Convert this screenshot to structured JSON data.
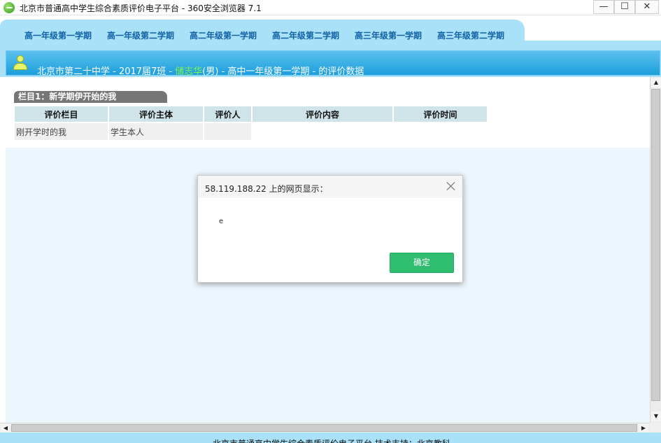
{
  "window": {
    "title": "北京市普通高中学生综合素质评价电子平台 - 360安全浏览器 7.1",
    "minimize": "—",
    "maximize": "☐",
    "close": "✕"
  },
  "tabs": [
    {
      "label": "高一年级第一学期"
    },
    {
      "label": "高一年级第二学期"
    },
    {
      "label": "高二年级第一学期"
    },
    {
      "label": "高二年级第二学期"
    },
    {
      "label": "高三年级第一学期"
    },
    {
      "label": "高三年级第二学期"
    }
  ],
  "header": {
    "prefix": "北京市第二十中学 - 2017届7班 - ",
    "student_name": "储志华",
    "suffix": "(男) - 高中一年级第一学期 - 的评价数据"
  },
  "section": {
    "title": "栏目1：新学期伊开始的我",
    "columns": [
      "评价栏目",
      "评价主体",
      "评价人",
      "评价内容",
      "评价时间"
    ],
    "rows": [
      {
        "category": "刚开学时的我",
        "subject": "学生本人",
        "evaluator": "",
        "content": "",
        "time": ""
      }
    ]
  },
  "dialog": {
    "title": "58.119.188.22 上的网页显示：",
    "message": "e",
    "ok_label": "确定"
  },
  "footer": {
    "text": "北京市普通高中学生综合素质评价电子平台   技术支持：北京教科"
  },
  "colors": {
    "accent": "#a9e1f8",
    "header_bar": "#1e9fdc",
    "tab_text": "#1263a6",
    "ok_button": "#2fbd6f",
    "student_name": "#7ef54d"
  }
}
